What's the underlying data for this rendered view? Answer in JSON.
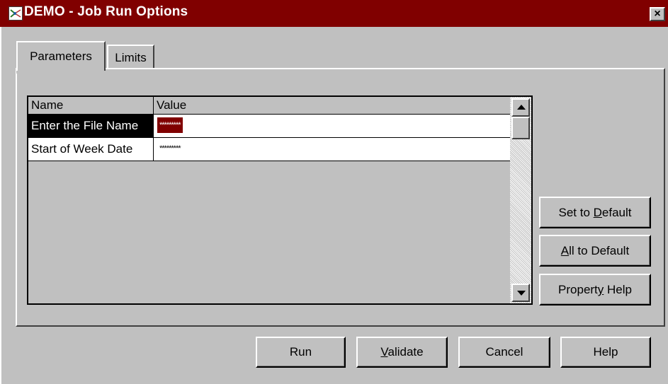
{
  "window": {
    "title": "DEMO - Job Run Options",
    "icon": "app-icon",
    "close_label": "×"
  },
  "tabs": [
    {
      "label": "Parameters",
      "active": true
    },
    {
      "label": "Limits",
      "active": false
    }
  ],
  "grid": {
    "columns": [
      "Name",
      "Value"
    ],
    "rows": [
      {
        "name": "Enter the File Name",
        "value": "*********",
        "selected": true
      },
      {
        "name": "Start of Week Date",
        "value": "*********",
        "selected": false
      }
    ]
  },
  "side_buttons": {
    "set_to_default": {
      "pre": "Set to ",
      "mnemonic": "D",
      "post": "efault"
    },
    "all_to_default": {
      "pre": "",
      "mnemonic": "A",
      "post": "ll to Default"
    },
    "property_help": {
      "pre": "Propert",
      "mnemonic": "y",
      "post": " Help"
    }
  },
  "bottom_buttons": {
    "run": {
      "pre": "Run",
      "mnemonic": "",
      "post": ""
    },
    "validate": {
      "pre": "",
      "mnemonic": "V",
      "post": "alidate"
    },
    "cancel": {
      "pre": "Cancel",
      "mnemonic": "",
      "post": ""
    },
    "help": {
      "pre": "Help",
      "mnemonic": "",
      "post": ""
    }
  },
  "colors": {
    "titlebar": "#800000",
    "face": "#c0c0c0",
    "selection_name": "#000000",
    "selection_value": "#800000"
  }
}
